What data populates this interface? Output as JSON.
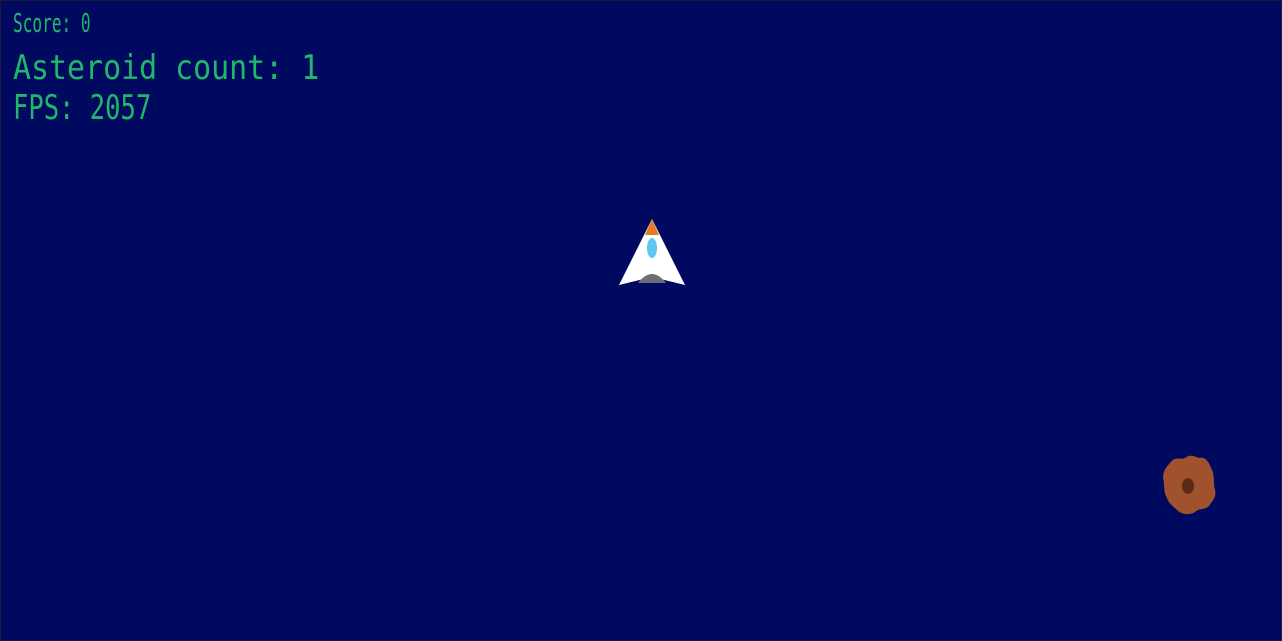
{
  "hud": {
    "score_text": "Score: 0",
    "asteroid_count_text": "Asteroid count: 1",
    "fps_text": "FPS: 2057"
  },
  "colors": {
    "background": "#000960",
    "hud_text": "#1fb86a",
    "ship_body": "#ffffff",
    "ship_nose": "#e8782a",
    "ship_window": "#5cc8f0",
    "ship_exhaust": "#6e6e78",
    "asteroid_body": "#a0522d",
    "asteroid_crater": "#5a2a14"
  },
  "sprites": {
    "ship_icon": "rocket-ship-icon",
    "asteroid_icon": "asteroid-icon"
  }
}
